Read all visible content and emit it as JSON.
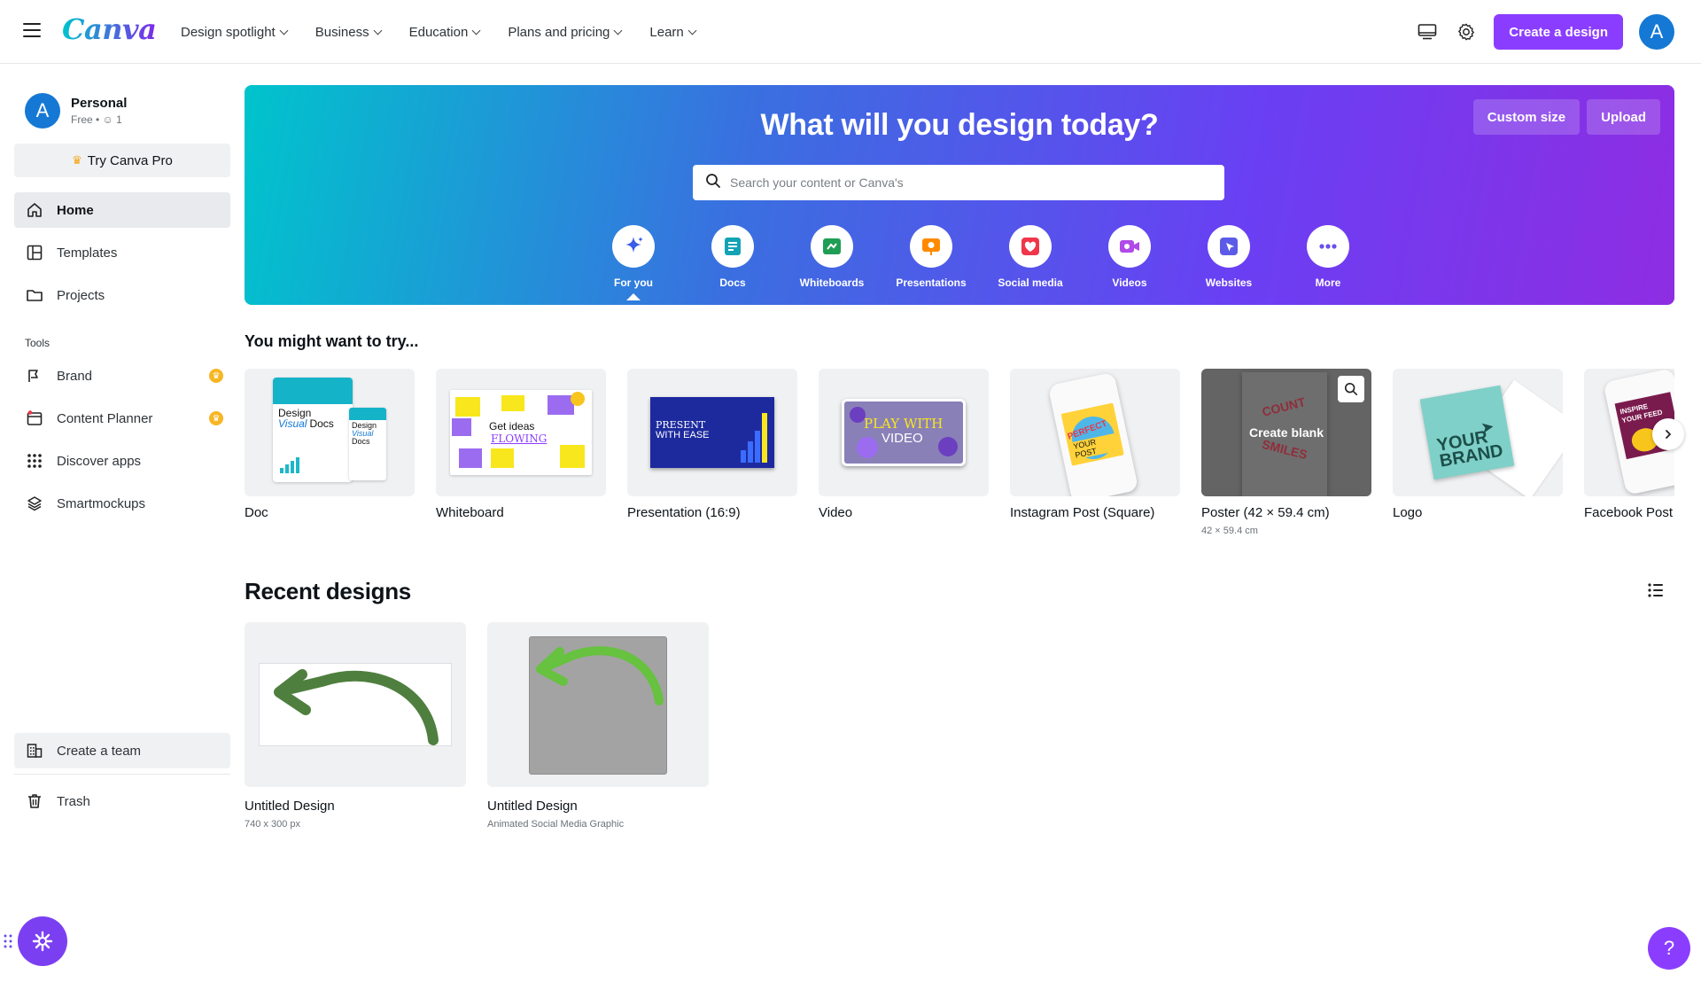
{
  "brand": {
    "logo_text": "Canva",
    "accent": "#8b3dff"
  },
  "nav": {
    "links": [
      "Design spotlight",
      "Business",
      "Education",
      "Plans and pricing",
      "Learn"
    ],
    "create_label": "Create a design",
    "avatar_letter": "A"
  },
  "sidebar": {
    "account_name": "Personal",
    "account_sub": "Free • ",
    "account_members": "1",
    "avatar_letter": "A",
    "try_pro": "Try Canva Pro",
    "items": [
      {
        "label": "Home",
        "icon": "home-icon"
      },
      {
        "label": "Templates",
        "icon": "templates-icon"
      },
      {
        "label": "Projects",
        "icon": "folder-icon"
      }
    ],
    "tools_heading": "Tools",
    "tools": [
      {
        "label": "Brand",
        "icon": "brand-icon",
        "pro": true
      },
      {
        "label": "Content Planner",
        "icon": "calendar-icon",
        "pro": true
      },
      {
        "label": "Discover apps",
        "icon": "apps-grid-icon",
        "pro": false
      },
      {
        "label": "Smartmockups",
        "icon": "layers-icon",
        "pro": false
      }
    ],
    "create_team": "Create a team",
    "trash": "Trash"
  },
  "hero": {
    "title": "What will you design today?",
    "custom_size": "Custom size",
    "upload": "Upload",
    "search_placeholder": "Search your content or Canva's",
    "categories": [
      "For you",
      "Docs",
      "Whiteboards",
      "Presentations",
      "Social media",
      "Videos",
      "Websites",
      "More"
    ],
    "category_colors": [
      "#3a5ce8",
      "#13a3b5",
      "#1f9d55",
      "#ff8a00",
      "#f0364a",
      "#b04ae8",
      "#5b5be8",
      "#6b4fe8"
    ]
  },
  "try_section": {
    "title": "You might want to try...",
    "cards": [
      {
        "name": "Doc",
        "dim": ""
      },
      {
        "name": "Whiteboard",
        "dim": ""
      },
      {
        "name": "Presentation (16:9)",
        "dim": ""
      },
      {
        "name": "Video",
        "dim": ""
      },
      {
        "name": "Instagram Post (Square)",
        "dim": ""
      },
      {
        "name": "Poster (42 × 59.4 cm)",
        "dim": "42 × 59.4 cm",
        "hover_label": "Create blank"
      },
      {
        "name": "Logo",
        "dim": ""
      },
      {
        "name": "Facebook Post",
        "dim": ""
      }
    ],
    "thumb_text": {
      "doc": [
        "Design",
        "Visual",
        "Docs"
      ],
      "whiteboard": [
        "Get ideas",
        "FLOWING"
      ],
      "presentation": [
        "PRESENT",
        "WITH EASE"
      ],
      "video": [
        "PLAY WITH",
        "VIDEO"
      ],
      "instagram": [
        "PERFECT",
        "YOUR POST"
      ],
      "poster": [
        "COUNT",
        "SMILES"
      ],
      "logo": [
        "YOUR",
        "BRAND"
      ],
      "facebook": [
        "INSPIRE",
        "YOUR FEED"
      ]
    }
  },
  "recent": {
    "title": "Recent designs",
    "designs": [
      {
        "name": "Untitled Design",
        "meta": "740 x 300 px"
      },
      {
        "name": "Untitled Design",
        "meta": "Animated Social Media Graphic"
      }
    ]
  },
  "help_label": "?"
}
